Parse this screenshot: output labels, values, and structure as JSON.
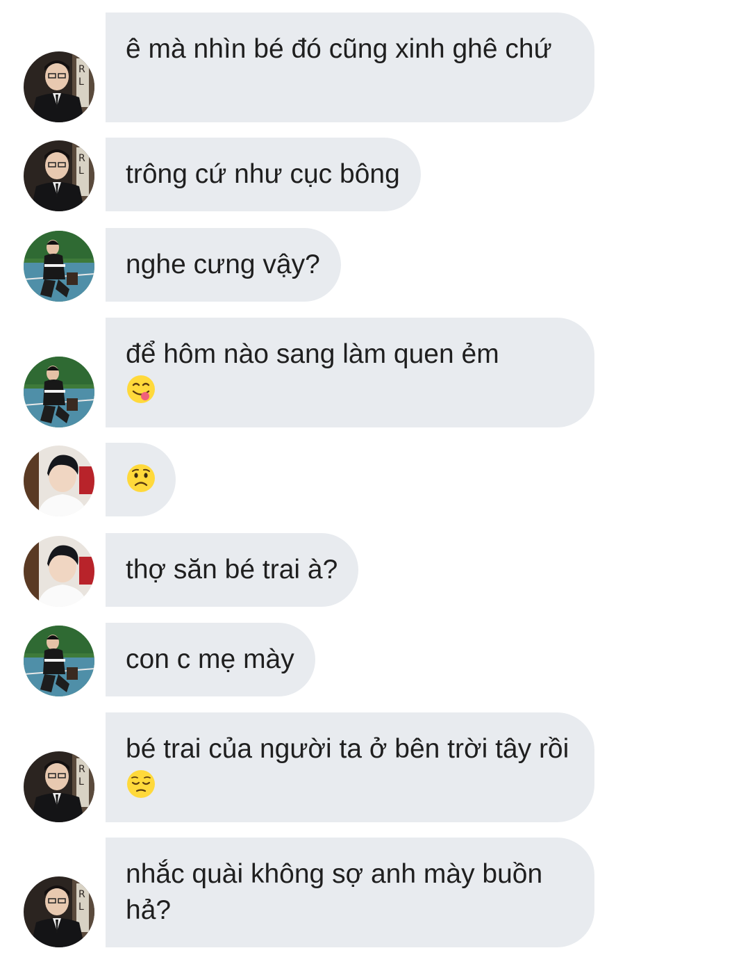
{
  "conversation": {
    "messages": [
      {
        "sender": "suit-avatar",
        "text": "ê mà nhìn bé đó cũng xinh ghê chứ"
      },
      {
        "sender": "suit-avatar",
        "text": "trông cứ như cục bông"
      },
      {
        "sender": "court-avatar",
        "text": "nghe cưng vậy?"
      },
      {
        "sender": "court-avatar",
        "text": "để hôm nào sang làm quen ẻm",
        "emoji": "face-savoring-food-icon"
      },
      {
        "sender": "white-shirt-avatar",
        "text": "",
        "emoji": "worried-face-icon"
      },
      {
        "sender": "white-shirt-avatar",
        "text": "thợ săn bé trai à?"
      },
      {
        "sender": "court-avatar",
        "text": "con c mẹ mày"
      },
      {
        "sender": "suit-avatar",
        "text": "bé trai của người ta ở bên trời tây rồi",
        "emoji": "pensive-face-icon"
      },
      {
        "sender": "suit-avatar",
        "text": "nhắc quài không sợ anh mày buồn hả?"
      }
    ]
  },
  "colors": {
    "bubble": "#e8ebef",
    "text": "#1f1f1f",
    "background": "#ffffff"
  }
}
